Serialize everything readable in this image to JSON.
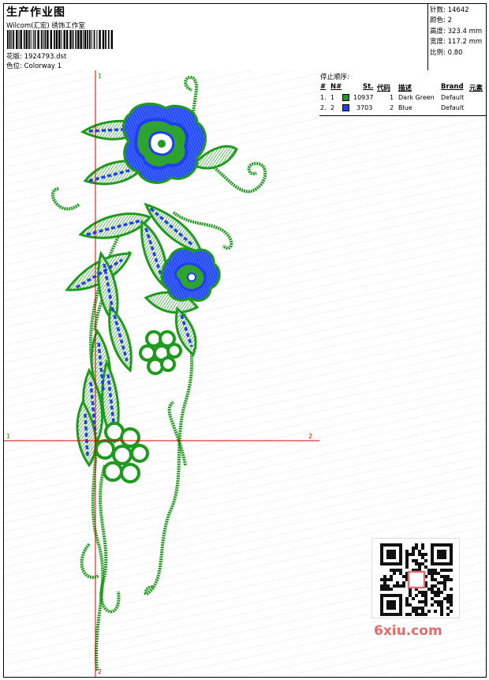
{
  "header": {
    "title": "生产作业图",
    "studio": "Wilcom(汇宏) 绣饰工作室",
    "design_label": "花版:",
    "design_value": "1924793.dst",
    "colorway_label": "色位:",
    "colorway_value": "Colorway 1"
  },
  "stats": [
    {
      "label": "针数:",
      "value": "14642"
    },
    {
      "label": "颜色:",
      "value": "2"
    },
    {
      "label": "高度:",
      "value": "323.4 mm"
    },
    {
      "label": "宽度:",
      "value": "117.2 mm"
    },
    {
      "label": "比例:",
      "value": "0.80"
    }
  ],
  "stop_sequence": {
    "title": "停止顺序:",
    "columns": [
      "#",
      "N#",
      "St.",
      "代码",
      "描述",
      "Brand",
      "元素"
    ],
    "rows": [
      {
        "idx": "1.",
        "n": "1",
        "color": "#1e9a1e",
        "stitches": "10937",
        "code": "1",
        "desc": "Dark Green",
        "brand": "Default"
      },
      {
        "idx": "2.",
        "n": "2",
        "color": "#1f3ff0",
        "stitches": "3703",
        "code": "2",
        "desc": "Blue",
        "brand": "Default"
      }
    ]
  },
  "axes": {
    "v_top": "1",
    "v_bottom": "2",
    "h_left": "1",
    "h_right": "2"
  },
  "watermark": "6xiu.com",
  "colors": {
    "thread_green": "#1e9a1e",
    "thread_blue": "#1f3ff0",
    "guide_red": "#d40000"
  }
}
